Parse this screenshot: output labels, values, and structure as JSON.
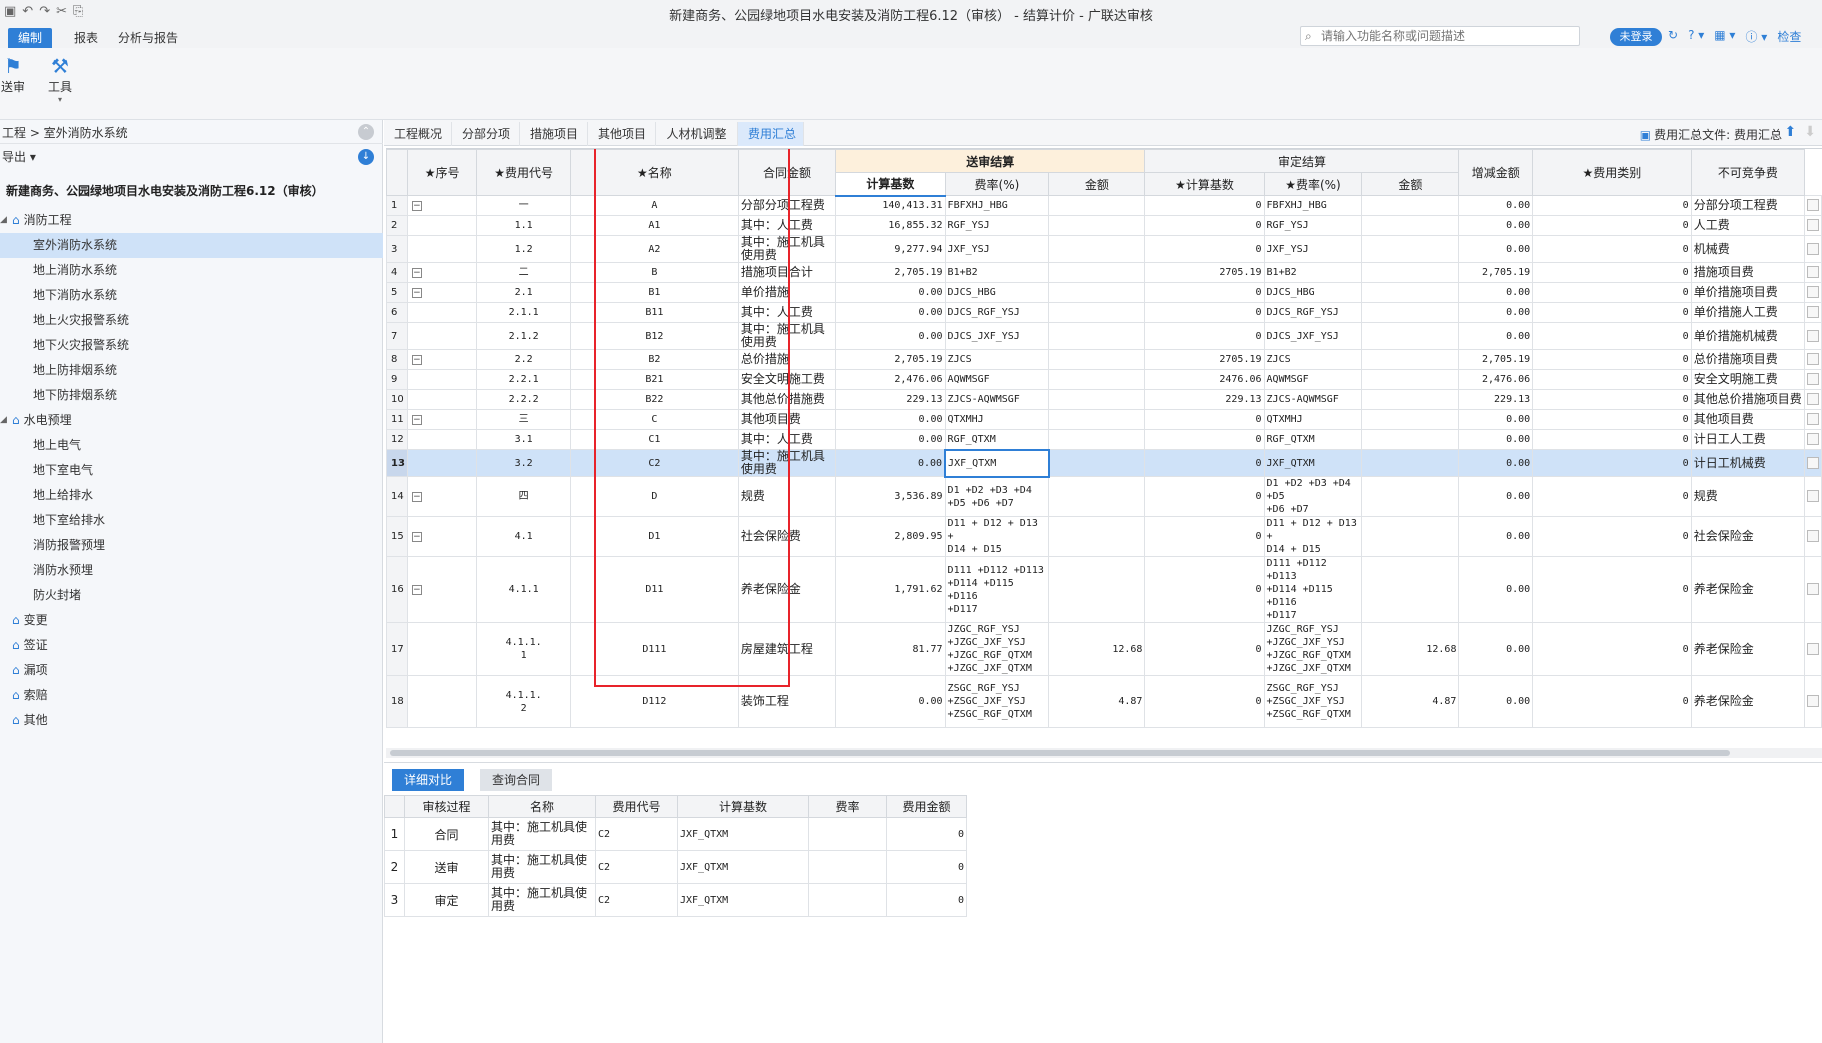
{
  "window": {
    "title": "新建商务、公园绿地项目水电安装及消防工程6.12（审核） - 结算计价 - 广联达审核",
    "quick_access": [
      "▣",
      "↶",
      "↷",
      "✂",
      "⎘"
    ]
  },
  "menu": {
    "tabs": [
      "编制",
      "报表",
      "分析与报告"
    ],
    "search_placeholder": "请输入功能名称或问题描述",
    "login": "未登录",
    "right_icons": [
      "↻",
      "? ▾",
      "▦ ▾",
      "ⓘ ▾",
      "检查"
    ]
  },
  "ribbon": {
    "buttons": [
      {
        "label": "送审",
        "icon": "send-icon"
      },
      {
        "label": "工具",
        "icon": "tool-icon"
      }
    ]
  },
  "left": {
    "breadcrumb": "工程 > 室外消防水系统",
    "export_label": "导出 ▾",
    "project_title": "新建商务、公园绿地项目水电安装及消防工程6.12（审核）",
    "tree": [
      {
        "label": "消防工程",
        "level": 1,
        "expanded": true
      },
      {
        "label": "室外消防水系统",
        "level": 2,
        "selected": true
      },
      {
        "label": "地上消防水系统",
        "level": 2
      },
      {
        "label": "地下消防水系统",
        "level": 2
      },
      {
        "label": "地上火灾报警系统",
        "level": 2
      },
      {
        "label": "地下火灾报警系统",
        "level": 2
      },
      {
        "label": "地上防排烟系统",
        "level": 2
      },
      {
        "label": "地下防排烟系统",
        "level": 2
      },
      {
        "label": "水电预埋",
        "level": 1,
        "expanded": true
      },
      {
        "label": "地上电气",
        "level": 2
      },
      {
        "label": "地下室电气",
        "level": 2
      },
      {
        "label": "地上给排水",
        "level": 2
      },
      {
        "label": "地下室给排水",
        "level": 2
      },
      {
        "label": "消防报警预埋",
        "level": 2
      },
      {
        "label": "消防水预埋",
        "level": 2
      },
      {
        "label": "防火封堵",
        "level": 2
      },
      {
        "label": "变更",
        "level": 1
      },
      {
        "label": "签证",
        "level": 1
      },
      {
        "label": "漏项",
        "level": 1
      },
      {
        "label": "索赔",
        "level": 1
      },
      {
        "label": "其他",
        "level": 1
      }
    ]
  },
  "main": {
    "tabs": [
      "工程概况",
      "分部分项",
      "措施项目",
      "其他项目",
      "人材机调整",
      "费用汇总"
    ],
    "active_tab": 5,
    "summary_file_label": "费用汇总文件:",
    "summary_file_value": "费用汇总",
    "grid": {
      "group_headers": {
        "submit": "送审结算",
        "approved": "审定结算"
      },
      "headers": [
        "★序号",
        "★费用代号",
        "★名称",
        "合同金额",
        "计算基数",
        "费率(%)",
        "金额",
        "★计算基数",
        "★费率(%)",
        "金额",
        "增减金额",
        "★费用类别",
        "不可竞争费"
      ],
      "rows": [
        {
          "n": "1",
          "toggle": "−",
          "seq": "一",
          "code": "A",
          "name": "分部分项工程费",
          "contract": "140,413.31",
          "sbase": "FBFXHJ_HBG",
          "srate": "",
          "samt": "0",
          "abase": "FBFXHJ_HBG",
          "arate": "",
          "aamt": "0.00",
          "diff": "0",
          "cat": "分部分项工程费"
        },
        {
          "n": "2",
          "toggle": "",
          "seq": "1.1",
          "code": "A1",
          "name": "其中：人工费",
          "contract": "16,855.32",
          "sbase": "RGF_YSJ",
          "srate": "",
          "samt": "0",
          "abase": "RGF_YSJ",
          "arate": "",
          "aamt": "0.00",
          "diff": "0",
          "cat": "人工费"
        },
        {
          "n": "3",
          "toggle": "",
          "seq": "1.2",
          "code": "A2",
          "name": "其中：施工机具使用费",
          "contract": "9,277.94",
          "sbase": "JXF_YSJ",
          "srate": "",
          "samt": "0",
          "abase": "JXF_YSJ",
          "arate": "",
          "aamt": "0.00",
          "diff": "0",
          "cat": "机械费"
        },
        {
          "n": "4",
          "toggle": "−",
          "seq": "二",
          "code": "B",
          "name": "措施项目合计",
          "contract": "2,705.19",
          "sbase": "B1+B2",
          "srate": "",
          "samt": "2705.19",
          "abase": "B1+B2",
          "arate": "",
          "aamt": "2,705.19",
          "diff": "0",
          "cat": "措施项目费"
        },
        {
          "n": "5",
          "toggle": "−",
          "seq": "2.1",
          "code": "B1",
          "name": "单价措施",
          "contract": "0.00",
          "sbase": "DJCS_HBG",
          "srate": "",
          "samt": "0",
          "abase": "DJCS_HBG",
          "arate": "",
          "aamt": "0.00",
          "diff": "0",
          "cat": "单价措施项目费"
        },
        {
          "n": "6",
          "toggle": "",
          "seq": "2.1.1",
          "code": "B11",
          "name": "其中：人工费",
          "contract": "0.00",
          "sbase": "DJCS_RGF_YSJ",
          "srate": "",
          "samt": "0",
          "abase": "DJCS_RGF_YSJ",
          "arate": "",
          "aamt": "0.00",
          "diff": "0",
          "cat": "单价措施人工费"
        },
        {
          "n": "7",
          "toggle": "",
          "seq": "2.1.2",
          "code": "B12",
          "name": "其中：施工机具使用费",
          "contract": "0.00",
          "sbase": "DJCS_JXF_YSJ",
          "srate": "",
          "samt": "0",
          "abase": "DJCS_JXF_YSJ",
          "arate": "",
          "aamt": "0.00",
          "diff": "0",
          "cat": "单价措施机械费"
        },
        {
          "n": "8",
          "toggle": "−",
          "seq": "2.2",
          "code": "B2",
          "name": "总价措施",
          "contract": "2,705.19",
          "sbase": "ZJCS",
          "srate": "",
          "samt": "2705.19",
          "abase": "ZJCS",
          "arate": "",
          "aamt": "2,705.19",
          "diff": "0",
          "cat": "总价措施项目费"
        },
        {
          "n": "9",
          "toggle": "",
          "seq": "2.2.1",
          "code": "B21",
          "name": "安全文明施工费",
          "contract": "2,476.06",
          "sbase": "AQWMSGF",
          "srate": "",
          "samt": "2476.06",
          "abase": "AQWMSGF",
          "arate": "",
          "aamt": "2,476.06",
          "diff": "0",
          "cat": "安全文明施工费"
        },
        {
          "n": "10",
          "toggle": "",
          "seq": "2.2.2",
          "code": "B22",
          "name": "其他总价措施费",
          "contract": "229.13",
          "sbase": "ZJCS-AQWMSGF",
          "srate": "",
          "samt": "229.13",
          "abase": "ZJCS-AQWMSGF",
          "arate": "",
          "aamt": "229.13",
          "diff": "0",
          "cat": "其他总价措施项目费"
        },
        {
          "n": "11",
          "toggle": "−",
          "seq": "三",
          "code": "C",
          "name": "其他项目费",
          "contract": "0.00",
          "sbase": "QTXMHJ",
          "srate": "",
          "samt": "0",
          "abase": "QTXMHJ",
          "arate": "",
          "aamt": "0.00",
          "diff": "0",
          "cat": "其他项目费"
        },
        {
          "n": "12",
          "toggle": "",
          "seq": "3.1",
          "code": "C1",
          "name": "其中：人工费",
          "contract": "0.00",
          "sbase": "RGF_QTXM",
          "srate": "",
          "samt": "0",
          "abase": "RGF_QTXM",
          "arate": "",
          "aamt": "0.00",
          "diff": "0",
          "cat": "计日工人工费"
        },
        {
          "n": "13",
          "toggle": "",
          "seq": "3.2",
          "code": "C2",
          "name": "其中：施工机具使用费",
          "contract": "0.00",
          "sbase": "JXF_QTXM",
          "srate": "",
          "samt": "0",
          "abase": "JXF_QTXM",
          "arate": "",
          "aamt": "0.00",
          "diff": "0",
          "cat": "计日工机械费",
          "selected": true
        },
        {
          "n": "14",
          "toggle": "−",
          "seq": "四",
          "code": "D",
          "name": "规费",
          "contract": "3,536.89",
          "sbase": "D1 +D2 +D3 +D4\n+D5 +D6 +D7",
          "srate": "",
          "samt": "0",
          "abase": "D1 +D2 +D3 +D4 +D5\n+D6 +D7",
          "arate": "",
          "aamt": "0.00",
          "diff": "0",
          "cat": "规费"
        },
        {
          "n": "15",
          "toggle": "−",
          "seq": "4.1",
          "code": "D1",
          "name": "社会保险费",
          "contract": "2,809.95",
          "sbase": "D11 + D12 + D13 +\nD14 + D15",
          "srate": "",
          "samt": "0",
          "abase": "D11 + D12 + D13 +\nD14 + D15",
          "arate": "",
          "aamt": "0.00",
          "diff": "0",
          "cat": "社会保险金"
        },
        {
          "n": "16",
          "toggle": "−",
          "seq": "4.1.1",
          "code": "D11",
          "name": "养老保险金",
          "contract": "1,791.62",
          "sbase": "D111 +D112 +D113\n+D114 +D115 +D116\n+D117",
          "srate": "",
          "samt": "0",
          "abase": "D111 +D112 +D113\n+D114 +D115 +D116\n+D117",
          "arate": "",
          "aamt": "0.00",
          "diff": "0",
          "cat": "养老保险金"
        },
        {
          "n": "17",
          "toggle": "",
          "seq": "4.1.1.\n1",
          "code": "D111",
          "name": "房屋建筑工程",
          "contract": "81.77",
          "sbase": "JZGC_RGF_YSJ\n+JZGC_JXF_YSJ\n+JZGC_RGF_QTXM\n+JZGC_JXF_QTXM",
          "srate": "12.68",
          "samt": "0",
          "abase": "JZGC_RGF_YSJ\n+JZGC_JXF_YSJ\n+JZGC_RGF_QTXM\n+JZGC_JXF_QTXM",
          "arate": "12.68",
          "aamt": "0.00",
          "diff": "0",
          "cat": "养老保险金"
        },
        {
          "n": "18",
          "toggle": "",
          "seq": "4.1.1.\n2",
          "code": "D112",
          "name": "装饰工程",
          "contract": "0.00",
          "sbase": "ZSGC_RGF_YSJ\n+ZSGC_JXF_YSJ\n+ZSGC_RGF_QTXM",
          "srate": "4.87",
          "samt": "0",
          "abase": "ZSGC_RGF_YSJ\n+ZSGC_JXF_YSJ\n+ZSGC_RGF_QTXM",
          "arate": "4.87",
          "aamt": "0.00",
          "diff": "0",
          "cat": "养老保险金"
        }
      ]
    },
    "bottom": {
      "tabs": [
        "详细对比",
        "查询合同"
      ],
      "headers": [
        "审核过程",
        "名称",
        "费用代号",
        "计算基数",
        "费率",
        "费用金额"
      ],
      "rows": [
        {
          "n": "1",
          "process": "合同",
          "name": "其中：施工机具使\n用费",
          "code": "C2",
          "base": "JXF_QTXM",
          "rate": "",
          "amt": "0"
        },
        {
          "n": "2",
          "process": "送审",
          "name": "其中：施工机具使\n用费",
          "code": "C2",
          "base": "JXF_QTXM",
          "rate": "",
          "amt": "0"
        },
        {
          "n": "3",
          "process": "审定",
          "name": "其中：施工机具使\n用费",
          "code": "C2",
          "base": "JXF_QTXM",
          "rate": "",
          "amt": "0"
        }
      ]
    }
  },
  "colors": {
    "accent": "#2f7fd6",
    "highlight_box": "#e8232a",
    "selected_row": "#cfe2f8"
  }
}
